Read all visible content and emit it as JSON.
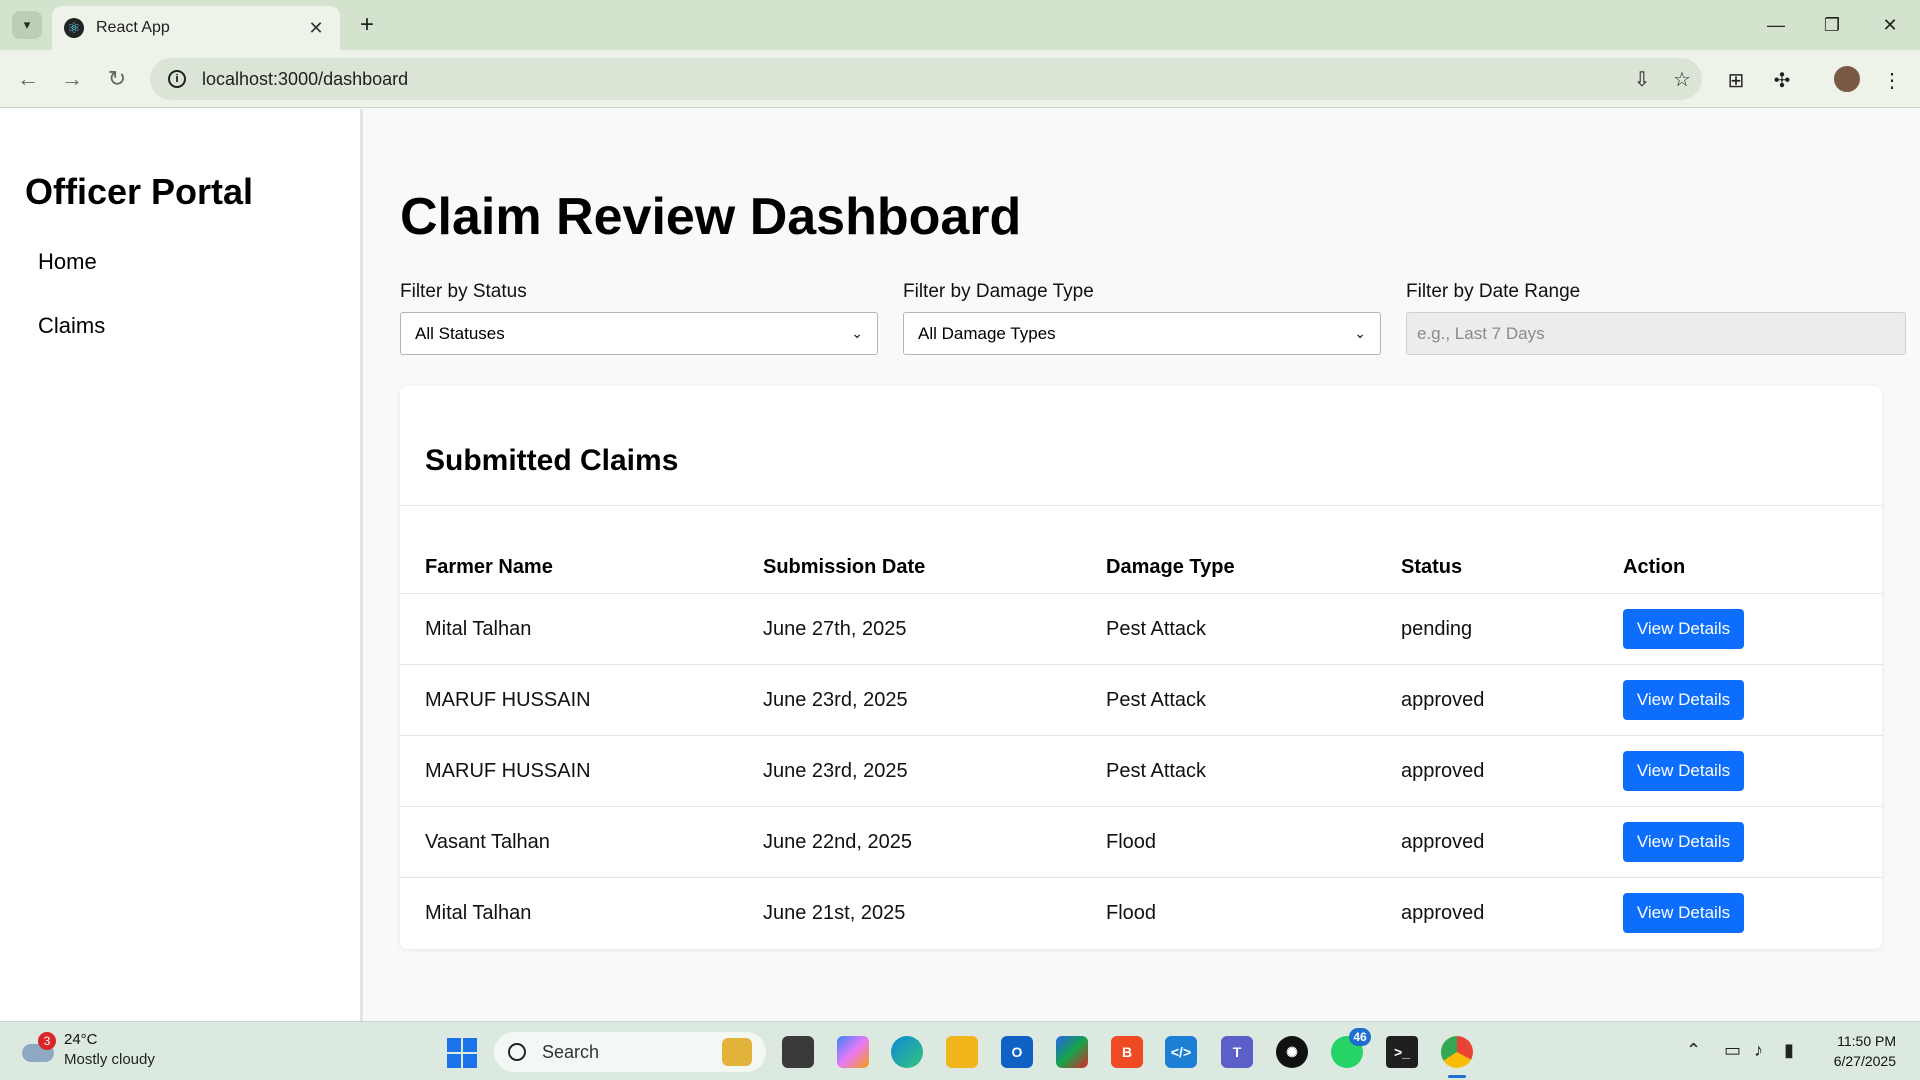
{
  "browser": {
    "tab_title": "React App",
    "tab_close": "✕",
    "new_tab": "+",
    "url": "localhost:3000/dashboard",
    "window_controls": {
      "minimize": "—",
      "maximize": "❐",
      "close": "✕"
    }
  },
  "sidebar": {
    "brand": "Officer Portal",
    "links": [
      {
        "label": "Home"
      },
      {
        "label": "Claims"
      }
    ]
  },
  "main": {
    "title": "Claim Review Dashboard",
    "filters": {
      "status": {
        "label": "Filter by Status",
        "value": "All Statuses"
      },
      "damage": {
        "label": "Filter by Damage Type",
        "value": "All Damage Types"
      },
      "date": {
        "label": "Filter by Date Range",
        "placeholder": "e.g., Last 7 Days"
      }
    },
    "card": {
      "title": "Submitted Claims",
      "columns": [
        "Farmer Name",
        "Submission Date",
        "Damage Type",
        "Status",
        "Action"
      ],
      "rows": [
        {
          "farmer": "Mital Talhan",
          "date": "June 27th, 2025",
          "damage": "Pest Attack",
          "status": "pending",
          "action": "View Details"
        },
        {
          "farmer": "MARUF HUSSAIN",
          "date": "June 23rd, 2025",
          "damage": "Pest Attack",
          "status": "approved",
          "action": "View Details"
        },
        {
          "farmer": "MARUF HUSSAIN",
          "date": "June 23rd, 2025",
          "damage": "Pest Attack",
          "status": "approved",
          "action": "View Details"
        },
        {
          "farmer": "Vasant Talhan",
          "date": "June 22nd, 2025",
          "damage": "Flood",
          "status": "approved",
          "action": "View Details"
        },
        {
          "farmer": "Mital Talhan",
          "date": "June 21st, 2025",
          "damage": "Flood",
          "status": "approved",
          "action": "View Details"
        }
      ]
    }
  },
  "taskbar": {
    "weather": {
      "temp": "24°C",
      "condition": "Mostly cloudy",
      "badge": "3"
    },
    "search_label": "Search",
    "whatsapp_badge": "46",
    "clock": {
      "time": "11:50 PM",
      "date": "6/27/2025"
    }
  },
  "colors": {
    "accent_button": "#0d6efd",
    "browser_frame": "#d3e3cd"
  }
}
